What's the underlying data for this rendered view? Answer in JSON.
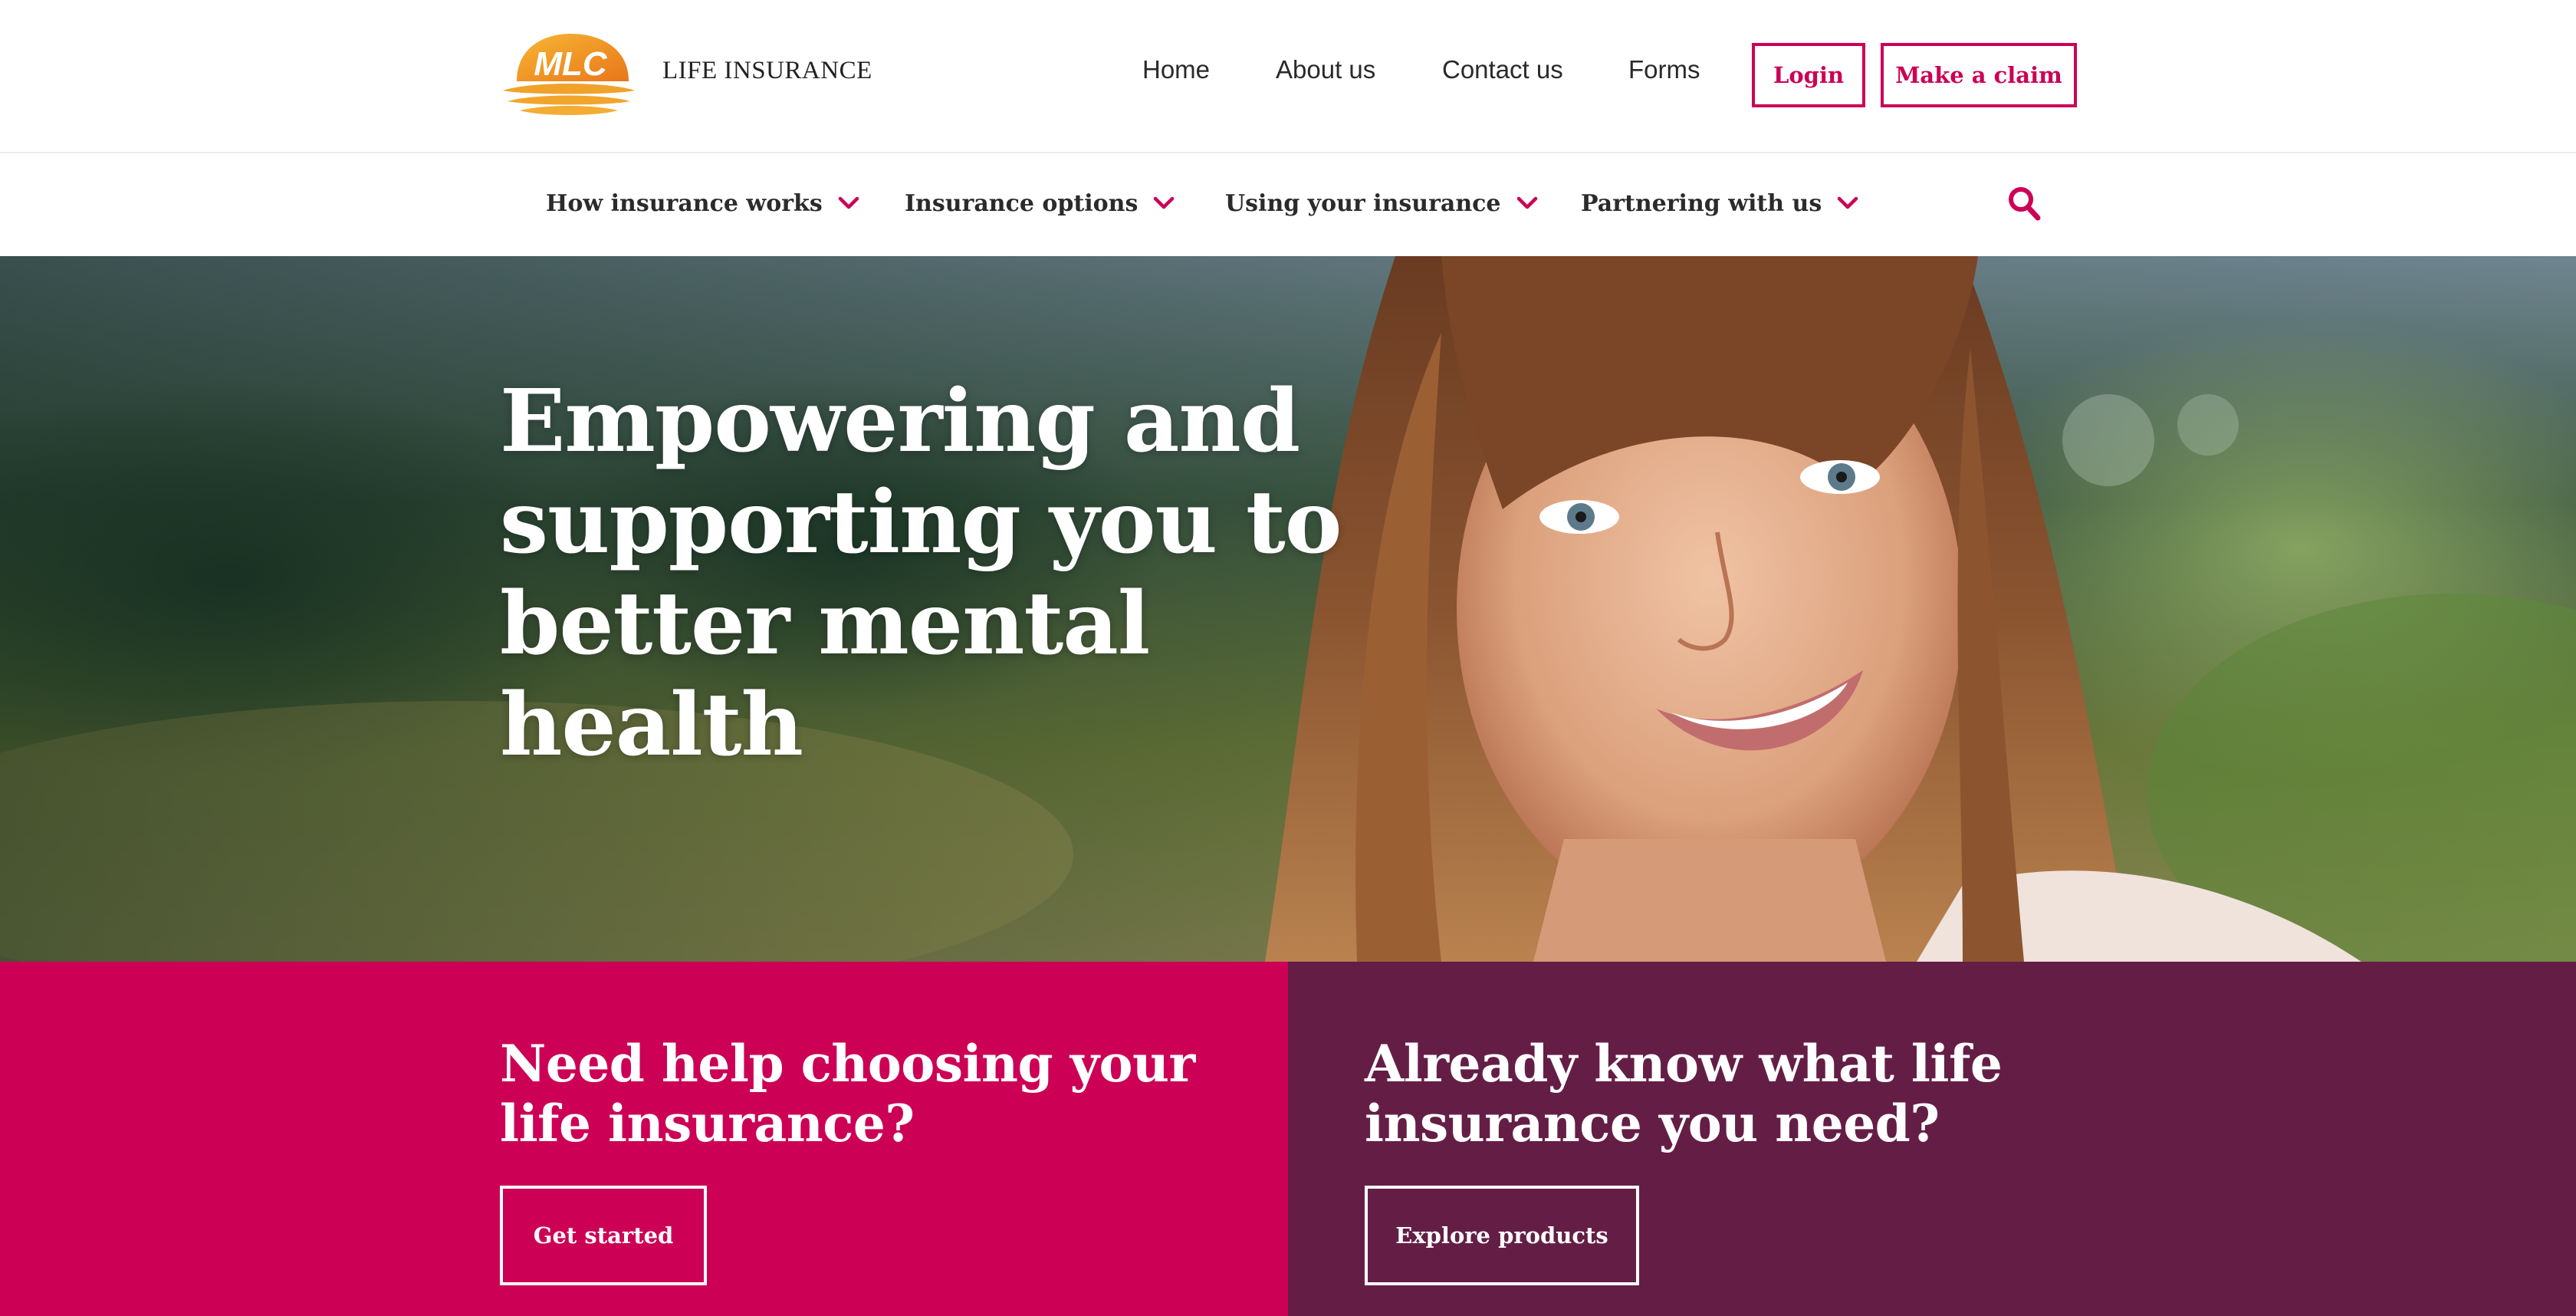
{
  "header": {
    "brand_text": "LIFE INSURANCE",
    "logo_text": "MLC",
    "links": {
      "home": "Home",
      "about": "About us",
      "contact": "Contact us",
      "forms": "Forms"
    },
    "login_label": "Login",
    "claim_label": "Make a claim"
  },
  "nav": {
    "items": [
      {
        "label": "How insurance works",
        "icon": "chevron-down-icon"
      },
      {
        "label": "Insurance options",
        "icon": "chevron-down-icon"
      },
      {
        "label": "Using your insurance",
        "icon": "chevron-down-icon"
      },
      {
        "label": "Partnering with us",
        "icon": "chevron-down-icon"
      }
    ],
    "search_icon": "search-icon"
  },
  "hero": {
    "title": "Empowering and supporting you to better mental health"
  },
  "cta": {
    "left": {
      "title": "Need help choosing your life insurance?",
      "button": "Get started"
    },
    "right": {
      "title": "Already know what life insurance you need?",
      "button": "Explore products"
    }
  },
  "colors": {
    "brand_magenta": "#cc0055",
    "brand_plum": "#641e46",
    "logo_orange": "#f29a1f"
  }
}
